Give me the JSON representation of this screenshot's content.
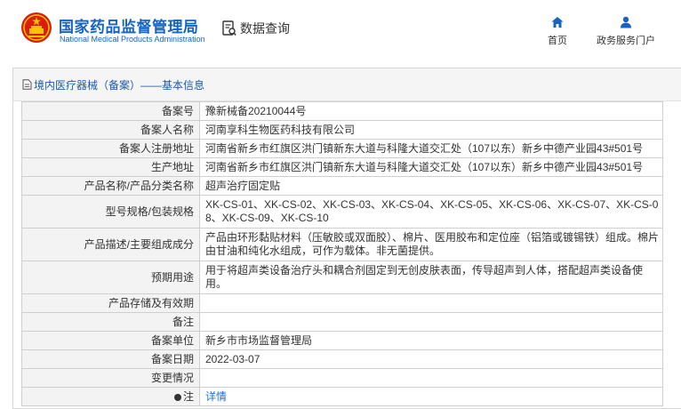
{
  "header": {
    "site_name_cn": "国家药品监督管理局",
    "site_name_en": "National Medical Products Administration",
    "query_label": "数据查询",
    "nav": {
      "home_label": "首页",
      "service_label": "政务服务门户"
    }
  },
  "card": {
    "title": "境内医疗器械（备案）——基本信息"
  },
  "table": {
    "rows": [
      {
        "label": "备案号",
        "value": "豫新械备20210044号"
      },
      {
        "label": "备案人名称",
        "value": "河南享科生物医药科技有限公司"
      },
      {
        "label": "备案人注册地址",
        "value": "河南省新乡市红旗区洪门镇新东大道与科隆大道交汇处（107以东）新乡中德产业园43#501号"
      },
      {
        "label": "生产地址",
        "value": "河南省新乡市红旗区洪门镇新东大道与科隆大道交汇处（107以东）新乡中德产业园43#501号"
      },
      {
        "label": "产品名称/产品分类名称",
        "value": "超声治疗固定贴"
      },
      {
        "label": "型号规格/包装规格",
        "value": "XK-CS-01、XK-CS-02、XK-CS-03、XK-CS-04、XK-CS-05、XK-CS-06、XK-CS-07、XK-CS-08、XK-CS-09、XK-CS-10"
      },
      {
        "label": "产品描述/主要组成成分",
        "value": "产品由环形黏贴材料（压敏胶或双面胶）、棉片、医用胶布和定位座（铝箔或镀锡铁）组成。棉片由甘油和纯化水组成，可作为载体。非无菌提供。"
      },
      {
        "label": "预期用途",
        "value": "用于将超声类设备治疗头和耦合剂固定到无创皮肤表面，传导超声到人体，搭配超声类设备使用。"
      },
      {
        "label": "产品存储及有效期",
        "value": ""
      },
      {
        "label": "备注",
        "value": ""
      },
      {
        "label": "备案单位",
        "value": "新乡市市场监督管理局"
      },
      {
        "label": "备案日期",
        "value": "2022-03-07"
      },
      {
        "label": "变更情况",
        "value": ""
      },
      {
        "label": "注",
        "value": "详情"
      }
    ]
  },
  "colors": {
    "brand_blue": "#1565c0",
    "emblem_red": "#d81e06",
    "link_blue": "#1e6fd9"
  },
  "icons": {
    "emblem": "national-emblem-icon",
    "query": "document-search-icon",
    "home": "home-icon",
    "service": "user-icon",
    "card_title": "document-icon",
    "note": "location-pin-icon"
  }
}
